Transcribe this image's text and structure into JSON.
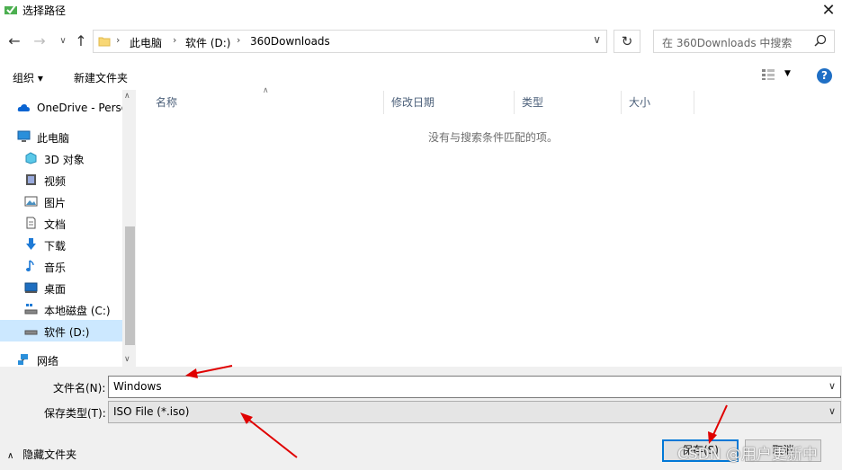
{
  "window": {
    "title": "选择路径"
  },
  "address": {
    "crumbs": [
      "此电脑",
      "软件 (D:)",
      "360Downloads"
    ]
  },
  "search": {
    "placeholder": "在 360Downloads 中搜索"
  },
  "toolbar": {
    "organize": "组织 ▾",
    "new_folder": "新建文件夹",
    "help": "?"
  },
  "nav": {
    "items": [
      {
        "label": "OneDrive - Perso",
        "icon": "cloud-icon"
      },
      {
        "label": "此电脑",
        "icon": "computer-icon"
      },
      {
        "label": "3D 对象",
        "icon": "cube-icon"
      },
      {
        "label": "视频",
        "icon": "video-icon"
      },
      {
        "label": "图片",
        "icon": "picture-icon"
      },
      {
        "label": "文档",
        "icon": "document-icon"
      },
      {
        "label": "下载",
        "icon": "download-icon"
      },
      {
        "label": "音乐",
        "icon": "music-icon"
      },
      {
        "label": "桌面",
        "icon": "desktop-icon"
      },
      {
        "label": "本地磁盘 (C:)",
        "icon": "drive-icon"
      },
      {
        "label": "软件 (D:)",
        "icon": "drive-icon"
      },
      {
        "label": "网络",
        "icon": "network-icon"
      }
    ]
  },
  "file_list": {
    "columns": [
      "名称",
      "修改日期",
      "类型",
      "大小"
    ],
    "empty_message": "没有与搜索条件匹配的项。"
  },
  "form": {
    "filename_label": "文件名(N):",
    "filename_value": "Windows",
    "filetype_label": "保存类型(T):",
    "filetype_value": "ISO File (*.iso)"
  },
  "footer": {
    "hide_folders": "隐藏文件夹",
    "save": "保存(S)",
    "cancel": "取消",
    "watermark": "CSDN @用户更新中"
  },
  "colors": {
    "accent": "#0078d7",
    "selected": "#cce8ff",
    "annotation_arrow": "#e00000"
  }
}
